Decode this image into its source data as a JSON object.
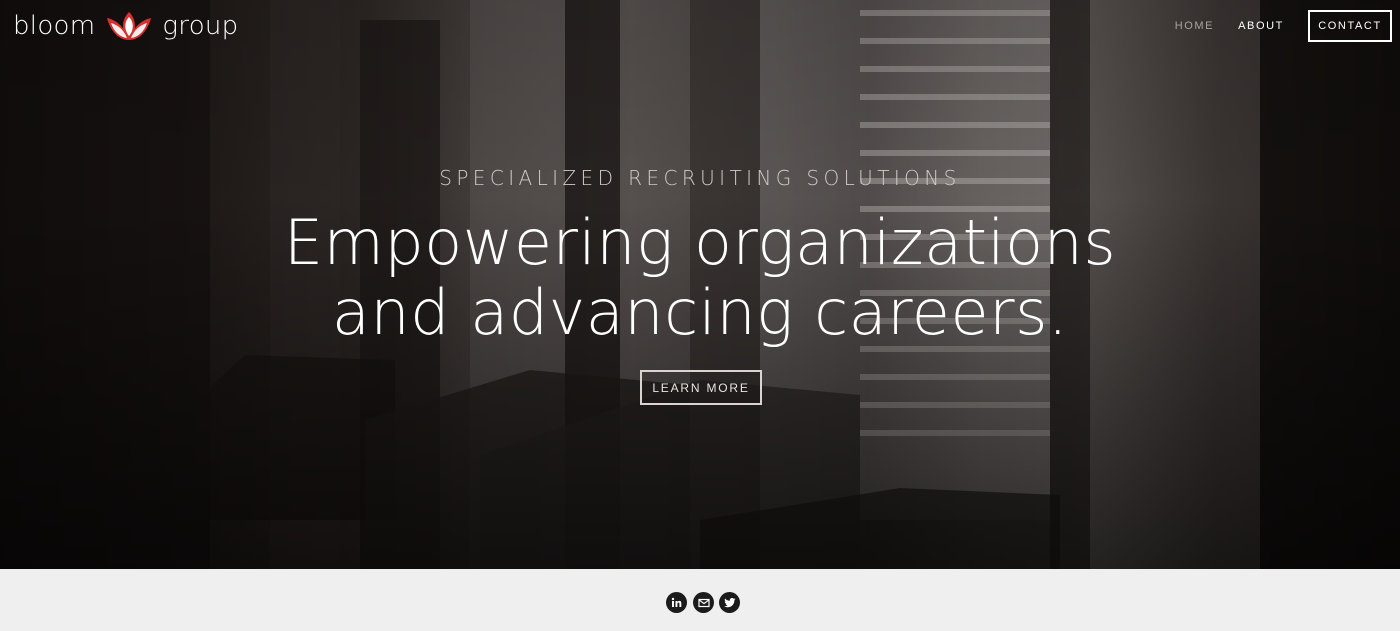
{
  "brand": {
    "name_left": "bloom",
    "name_right": "group",
    "logo_icon": "lotus-icon",
    "accent": "#d7312f"
  },
  "nav": {
    "home": "HOME",
    "about": "ABOUT",
    "contact": "CONTACT"
  },
  "hero": {
    "kicker": "SPECIALIZED RECRUITING SOLUTIONS",
    "headline_line1": "Empowering organizations",
    "headline_line2": "and advancing careers.",
    "cta": "LEARN MORE"
  },
  "footer": {
    "social": [
      "linkedin-icon",
      "email-icon",
      "twitter-icon"
    ]
  }
}
